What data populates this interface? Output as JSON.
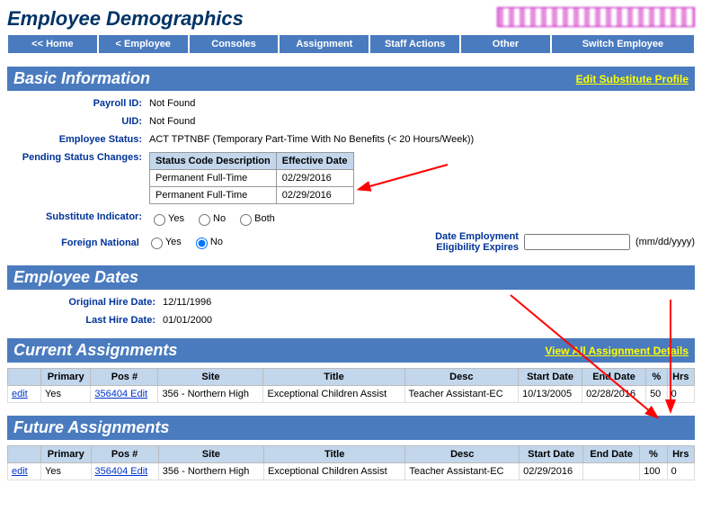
{
  "header": {
    "title": "Employee Demographics"
  },
  "nav": {
    "home": "<< Home",
    "employee": "< Employee",
    "consoles": "Consoles",
    "assignment": "Assignment",
    "staff_actions": "Staff Actions",
    "other": "Other",
    "switch": "Switch Employee"
  },
  "sections": {
    "basic": {
      "title": "Basic Information",
      "link": "Edit Substitute Profile",
      "payroll_label": "Payroll ID:",
      "payroll_value": "Not Found",
      "uid_label": "UID:",
      "uid_value": "Not Found",
      "status_label": "Employee Status:",
      "status_value": "ACT TPTNBF (Temporary Part-Time With No Benefits (< 20 Hours/Week))",
      "pending_label": "Pending Status Changes:",
      "pending_headers": {
        "a": "Status Code Description",
        "b": "Effective Date"
      },
      "pending_rows": [
        {
          "a": "Permanent Full-Time",
          "b": "02/29/2016"
        },
        {
          "a": "Permanent Full-Time",
          "b": "02/29/2016"
        }
      ],
      "sub_label": "Substitute Indicator:",
      "sub_yes": "Yes",
      "sub_no": "No",
      "sub_both": "Both",
      "foreign_label": "Foreign National",
      "fn_yes": "Yes",
      "fn_no": "No",
      "elig_label": "Date Employment Eligibility Expires",
      "elig_hint": "(mm/dd/yyyy)"
    },
    "dates": {
      "title": "Employee Dates",
      "orig_label": "Original Hire Date:",
      "orig_value": "12/11/1996",
      "last_label": "Last Hire Date:",
      "last_value": "01/01/2000"
    },
    "current": {
      "title": "Current Assignments",
      "link": "View All Assignment Details",
      "headers": {
        "edit": "",
        "primary": "Primary",
        "pos": "Pos #",
        "site": "Site",
        "title": "Title",
        "desc": "Desc",
        "start": "Start Date",
        "end": "End Date",
        "pct": "%",
        "hrs": "Hrs"
      },
      "rows": [
        {
          "edit": "edit",
          "primary": "Yes",
          "pos": "356404 Edit",
          "site": "356 - Northern High",
          "title": "Exceptional Children Assist",
          "desc": "Teacher Assistant-EC",
          "start": "10/13/2005",
          "end": "02/28/2016",
          "pct": "50",
          "hrs": "0"
        }
      ]
    },
    "future": {
      "title": "Future Assignments",
      "headers": {
        "edit": "",
        "primary": "Primary",
        "pos": "Pos #",
        "site": "Site",
        "title": "Title",
        "desc": "Desc",
        "start": "Start Date",
        "end": "End Date",
        "pct": "%",
        "hrs": "Hrs"
      },
      "rows": [
        {
          "edit": "edit",
          "primary": "Yes",
          "pos": "356404 Edit",
          "site": "356 - Northern High",
          "title": "Exceptional Children Assist",
          "desc": "Teacher Assistant-EC",
          "start": "02/29/2016",
          "end": "",
          "pct": "100",
          "hrs": "0"
        }
      ]
    }
  }
}
